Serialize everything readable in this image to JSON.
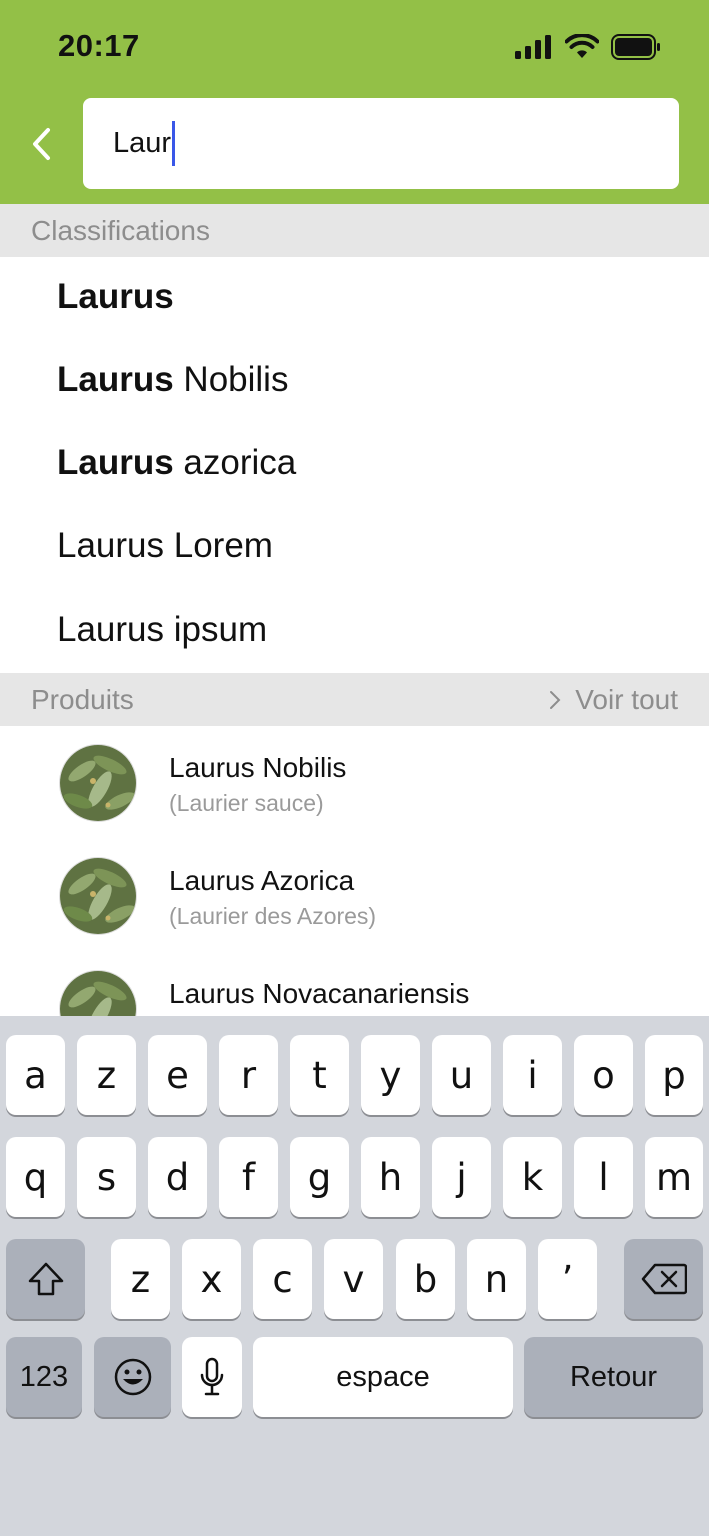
{
  "status_bar": {
    "time": "20:17"
  },
  "search": {
    "value": "Laur"
  },
  "sections": {
    "classifications": "Classifications",
    "products": "Produits",
    "see_all": "Voir tout"
  },
  "classifications": [
    {
      "bold": "Laurus",
      "rest": ""
    },
    {
      "bold": "Laurus",
      "rest": " Nobilis"
    },
    {
      "bold": "Laurus",
      "rest": " azorica"
    },
    {
      "bold": "",
      "rest": "Laurus Lorem"
    },
    {
      "bold": "",
      "rest": "Laurus ipsum"
    }
  ],
  "products": [
    {
      "name": "Laurus Nobilis",
      "common": "(Laurier sauce)"
    },
    {
      "name": "Laurus Azorica",
      "common": "(Laurier des Azores)"
    },
    {
      "name": "Laurus Novacanariensis",
      "common": ""
    }
  ],
  "keyboard": {
    "row1": [
      "a",
      "z",
      "e",
      "r",
      "t",
      "y",
      "u",
      "i",
      "o",
      "p"
    ],
    "row2": [
      "q",
      "s",
      "d",
      "f",
      "g",
      "h",
      "j",
      "k",
      "l",
      "m"
    ],
    "row3": [
      "z",
      "x",
      "c",
      "v",
      "b",
      "n",
      "ʼ"
    ],
    "numbers": "123",
    "space": "espace",
    "return": "Retour"
  },
  "colors": {
    "header": "#93c047",
    "caret": "#3a57e8"
  }
}
